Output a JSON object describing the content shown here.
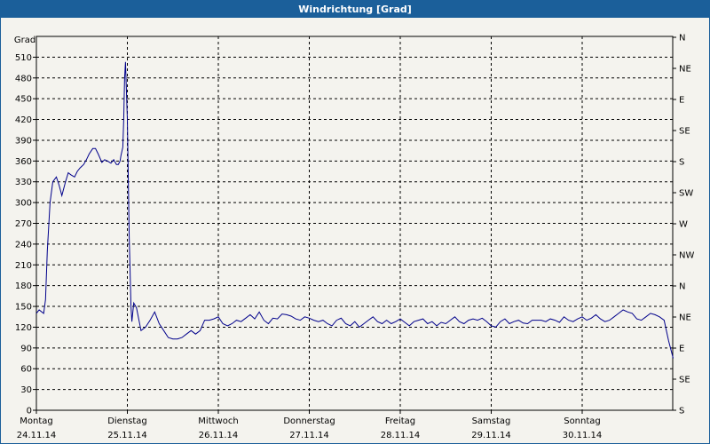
{
  "title": "Windrichtung [Grad]",
  "chart_data": {
    "type": "line",
    "ylabel": "Grad",
    "ylim": [
      0,
      540
    ],
    "yticks": [
      0,
      30,
      60,
      90,
      120,
      150,
      180,
      210,
      240,
      270,
      300,
      330,
      360,
      390,
      420,
      450,
      480,
      510
    ],
    "right_axis_labels": [
      "S",
      "SE",
      "E",
      "NE",
      "N",
      "NW",
      "W",
      "SW",
      "S",
      "SE",
      "E",
      "NE",
      "N"
    ],
    "x_labels": [
      {
        "day": "Montag",
        "date": "24.11.14"
      },
      {
        "day": "Dienstag",
        "date": "25.11.14"
      },
      {
        "day": "Mittwoch",
        "date": "26.11.14"
      },
      {
        "day": "Donnerstag",
        "date": "27.11.14"
      },
      {
        "day": "Freitag",
        "date": "28.11.14"
      },
      {
        "day": "Samstag",
        "date": "29.11.14"
      },
      {
        "day": "Sonntag",
        "date": "30.11.14"
      }
    ],
    "grid": true,
    "line_color": "#00008b",
    "series": [
      {
        "x": [
          0.0,
          0.03,
          0.08,
          0.1,
          0.12,
          0.15,
          0.18,
          0.22,
          0.25,
          0.28,
          0.32,
          0.35,
          0.38,
          0.42,
          0.45,
          0.48,
          0.52,
          0.55,
          0.58,
          0.62,
          0.65,
          0.68,
          0.72,
          0.75,
          0.78,
          0.82,
          0.85,
          0.88,
          0.9,
          0.92,
          0.93,
          0.95,
          0.96,
          0.97,
          0.98,
          1.0,
          1.02,
          1.04,
          1.05,
          1.07,
          1.1,
          1.15,
          1.2,
          1.25,
          1.3,
          1.35,
          1.4,
          1.45,
          1.5,
          1.55,
          1.6,
          1.65,
          1.7,
          1.75,
          1.8,
          1.85,
          1.9,
          1.95,
          2.0,
          2.05,
          2.1,
          2.15,
          2.2,
          2.25,
          2.3,
          2.35,
          2.4,
          2.45,
          2.5,
          2.55,
          2.6,
          2.65,
          2.7,
          2.75,
          2.8,
          2.85,
          2.9,
          2.95,
          3.0,
          3.05,
          3.1,
          3.15,
          3.2,
          3.25,
          3.3,
          3.35,
          3.4,
          3.45,
          3.5,
          3.55,
          3.6,
          3.65,
          3.7,
          3.75,
          3.8,
          3.85,
          3.9,
          3.95,
          4.0,
          4.05,
          4.1,
          4.15,
          4.2,
          4.25,
          4.3,
          4.35,
          4.4,
          4.45,
          4.5,
          4.55,
          4.6,
          4.65,
          4.7,
          4.75,
          4.8,
          4.85,
          4.9,
          4.95,
          5.0,
          5.05,
          5.1,
          5.15,
          5.2,
          5.25,
          5.3,
          5.35,
          5.4,
          5.45,
          5.5,
          5.55,
          5.6,
          5.65,
          5.7,
          5.75,
          5.8,
          5.85,
          5.9,
          5.95,
          6.0,
          6.05,
          6.1,
          6.15,
          6.2,
          6.25,
          6.3,
          6.35,
          6.4,
          6.45,
          6.5,
          6.55,
          6.6,
          6.65,
          6.7,
          6.75,
          6.8,
          6.85,
          6.9,
          6.95,
          7.0
        ],
        "y": [
          140,
          145,
          140,
          160,
          230,
          300,
          330,
          337,
          325,
          310,
          330,
          343,
          340,
          337,
          345,
          350,
          355,
          362,
          370,
          378,
          378,
          370,
          358,
          362,
          360,
          357,
          362,
          355,
          355,
          360,
          368,
          380,
          420,
          480,
          503,
          420,
          250,
          150,
          128,
          155,
          148,
          115,
          120,
          130,
          142,
          125,
          115,
          105,
          103,
          103,
          105,
          110,
          115,
          110,
          115,
          130,
          130,
          132,
          135,
          125,
          122,
          125,
          130,
          128,
          133,
          138,
          132,
          142,
          130,
          125,
          133,
          132,
          139,
          138,
          136,
          132,
          130,
          135,
          133,
          130,
          128,
          130,
          125,
          122,
          130,
          133,
          125,
          122,
          128,
          120,
          125,
          130,
          135,
          128,
          125,
          130,
          125,
          128,
          132,
          127,
          122,
          128,
          130,
          132,
          125,
          128,
          122,
          127,
          125,
          130,
          135,
          128,
          125,
          130,
          132,
          130,
          133,
          128,
          122,
          120,
          128,
          132,
          125,
          128,
          130,
          126,
          125,
          130,
          130,
          130,
          128,
          132,
          130,
          127,
          135,
          130,
          128,
          132,
          135,
          130,
          133,
          138,
          132,
          128,
          130,
          135,
          140,
          145,
          142,
          140,
          132,
          130,
          135,
          140,
          138,
          135,
          130,
          100,
          75
        ]
      }
    ]
  }
}
